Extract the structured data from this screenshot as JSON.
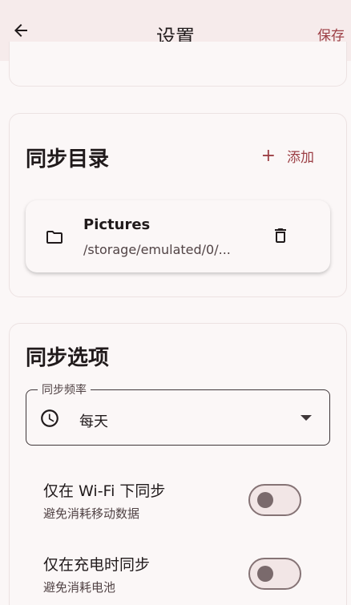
{
  "header": {
    "title": "设置",
    "save_label": "保存",
    "back_icon": "arrow-left-icon"
  },
  "sync_dirs": {
    "title": "同步目录",
    "add_label": "添加",
    "items": [
      {
        "name": "Pictures",
        "path": "/storage/emulated/0/...",
        "icon": "folder-icon",
        "action_icon": "trash-icon"
      }
    ]
  },
  "sync_options": {
    "title": "同步选项",
    "frequency": {
      "label": "同步频率",
      "value": "每天",
      "icon": "clock-icon"
    },
    "toggles": [
      {
        "label": "仅在 Wi-Fi 下同步",
        "subtitle": "避免消耗移动数据",
        "enabled": false
      },
      {
        "label": "仅在充电时同步",
        "subtitle": "避免消耗电池",
        "enabled": false
      }
    ]
  },
  "colors": {
    "primary": "#9c3f45",
    "appbar": "#f6ebeb",
    "background": "#fbf7f7"
  }
}
